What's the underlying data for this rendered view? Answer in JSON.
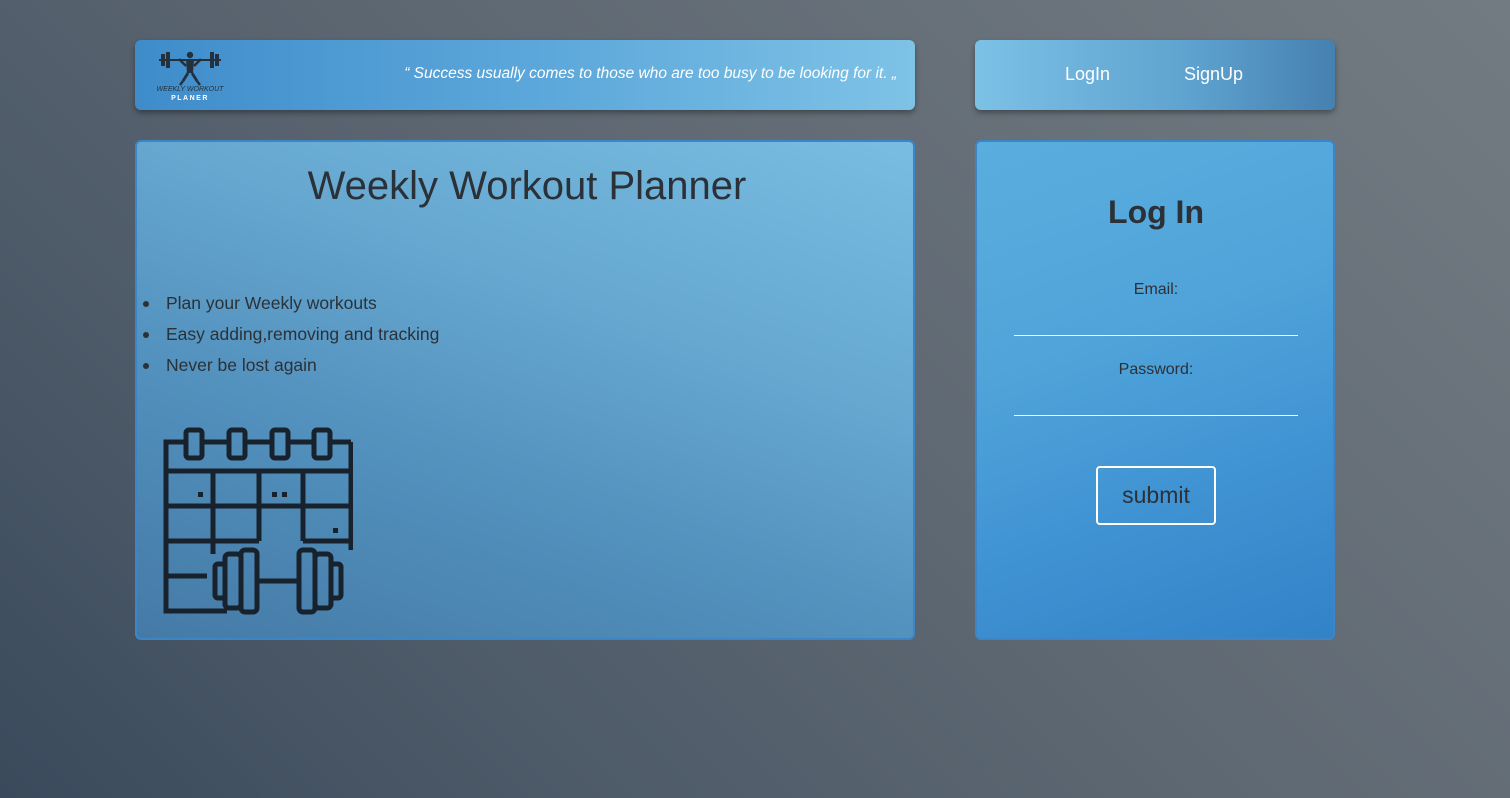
{
  "header": {
    "logo": {
      "line1": "WEEKLY WORKOUT",
      "line2": "PLANER",
      "icon": "weightlifter-icon"
    },
    "quote": "“ Success usually comes to those who are too busy to be looking for it. „"
  },
  "nav": {
    "login_label": "LogIn",
    "signup_label": "SignUp"
  },
  "main": {
    "title": "Weekly Workout Planner",
    "features": [
      "Plan your Weekly workouts",
      "Easy adding,removing and tracking",
      "Never be lost again"
    ],
    "illustration_icon": "calendar-dumbbell-icon"
  },
  "login": {
    "title": "Log In",
    "email_label": "Email:",
    "email_value": "",
    "password_label": "Password:",
    "password_value": "",
    "submit_label": "submit"
  },
  "colors": {
    "header_accent": "#4fa0d7",
    "card_border": "#3c86c8",
    "text_dark": "#2b3137",
    "background_dark": "#3a4a5c"
  }
}
